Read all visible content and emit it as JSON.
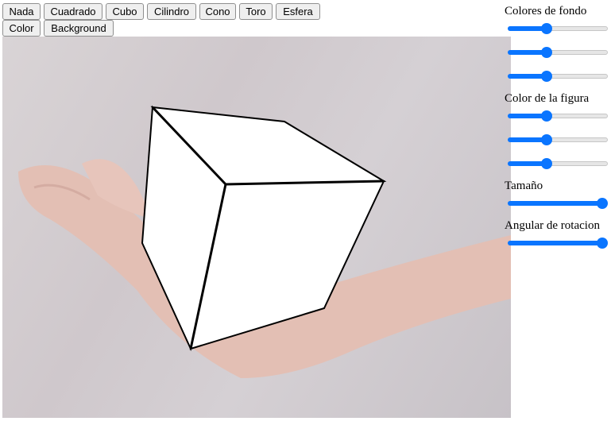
{
  "toolbar": {
    "buttons": [
      "Nada",
      "Cuadrado",
      "Cubo",
      "Cilindro",
      "Cono",
      "Toro",
      "Esfera",
      "Color",
      "Background"
    ]
  },
  "panel": {
    "background_label": "Colores de fondo",
    "shape_color_label": "Color de la figura",
    "size_label": "Tamaño",
    "rotation_label": "Angular de rotacion"
  },
  "sliders": {
    "bg_r": 0.39,
    "bg_g": 0.39,
    "bg_b": 0.39,
    "fig_r": 0.39,
    "fig_g": 0.39,
    "fig_b": 0.39,
    "size": 1.0,
    "rotation": 1.0
  },
  "colors": {
    "accent": "#0a75ff",
    "shape_fill": "#ffffff",
    "shape_edge": "#000000"
  },
  "scene": {
    "shape": "cube"
  }
}
